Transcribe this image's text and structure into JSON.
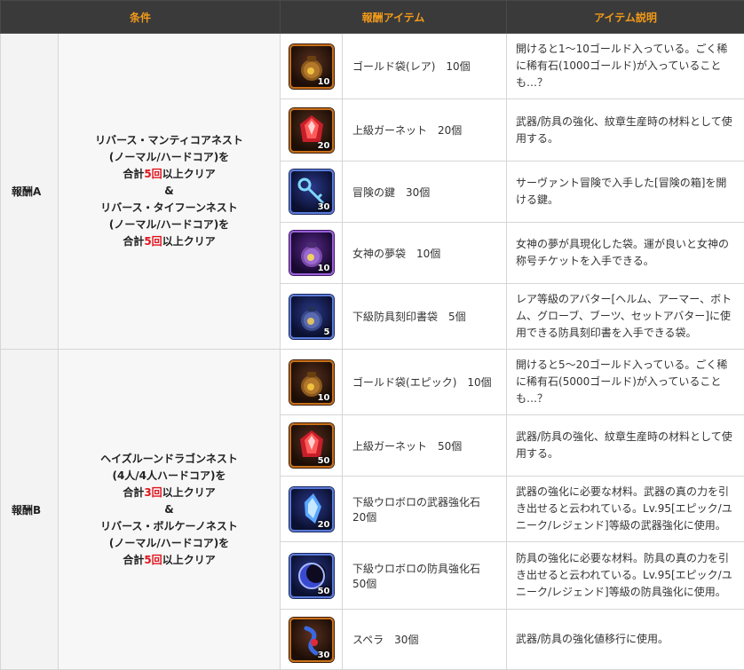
{
  "headers": {
    "condition": "条件",
    "reward_item": "報酬アイテム",
    "item_desc": "アイテム説明"
  },
  "rewards": [
    {
      "name": "報酬A",
      "condition": [
        {
          "text": "リバース・マンティコアネスト"
        },
        {
          "text": "(ノーマル/ハードコア)を"
        },
        {
          "pre": "合計",
          "num": "5回",
          "post": "以上クリア"
        },
        {
          "text": "&"
        },
        {
          "text": "リバース・タイフーンネスト"
        },
        {
          "text": "(ノーマル/ハードコア)を"
        },
        {
          "pre": "合計",
          "num": "5回",
          "post": "以上クリア"
        }
      ],
      "items": [
        {
          "icon": "gold-bag-icon",
          "qty": "10",
          "name": "ゴールド袋(レア)　10個",
          "desc": "開けると1～10ゴールド入っている。ごく稀に稀有石(1000ゴールド)が入っていることも…？"
        },
        {
          "icon": "garnet-icon",
          "qty": "20",
          "name": "上級ガーネット　20個",
          "desc": "武器/防具の強化、紋章生産時の材料として使用する。"
        },
        {
          "icon": "key-icon",
          "qty": "30",
          "name": "冒険の鍵　30個",
          "desc": "サーヴァント冒険で入手した[冒険の箱]を開ける鍵。"
        },
        {
          "icon": "goddess-bag-icon",
          "qty": "10",
          "name": "女神の夢袋　10個",
          "desc": "女神の夢が具現化した袋。運が良いと女神の称号チケットを入手できる。"
        },
        {
          "icon": "armor-seal-bag-icon",
          "qty": "5",
          "name": "下級防具刻印書袋　5個",
          "desc": "レア等級のアバター[ヘルム、アーマー、ボトム、グローブ、ブーツ、セットアバター]に使用できる防具刻印書を入手できる袋。"
        }
      ]
    },
    {
      "name": "報酬B",
      "condition": [
        {
          "text": "ヘイズルーンドラゴンネスト"
        },
        {
          "text": "(4人/4人ハードコア)を"
        },
        {
          "pre": "合計",
          "num": "3回",
          "post": "以上クリア"
        },
        {
          "text": "&"
        },
        {
          "text": "リバース・ボルケーノネスト"
        },
        {
          "text": "(ノーマル/ハードコア)を"
        },
        {
          "pre": "合計",
          "num": "5回",
          "post": "以上クリア"
        }
      ],
      "items": [
        {
          "icon": "gold-bag-icon",
          "qty": "10",
          "name": "ゴールド袋(エピック)　10個",
          "desc": "開けると5～20ゴールド入っている。ごく稀に稀有石(5000ゴールド)が入っていることも…？"
        },
        {
          "icon": "garnet-icon",
          "qty": "50",
          "name": "上級ガーネット　50個",
          "desc": "武器/防具の強化、紋章生産時の材料として使用する。"
        },
        {
          "icon": "weapon-stone-icon",
          "qty": "20",
          "name": "下級ウロボロの武器強化石",
          "name2": "20個",
          "desc": "武器の強化に必要な材料。武器の真の力を引き出せると云われている。Lv.95[エピック/ユニーク/レジェンド]等級の武器強化に使用。"
        },
        {
          "icon": "armor-stone-icon",
          "qty": "50",
          "name": "下級ウロボロの防具強化石",
          "name2": "50個",
          "desc": "防具の強化に必要な材料。防具の真の力を引き出せると云われている。Lv.95[エピック/ユニーク/レジェンド]等級の防具強化に使用。"
        },
        {
          "icon": "spera-icon",
          "qty": "30",
          "name": "スペラ　30個",
          "desc": "武器/防具の強化値移行に使用。"
        }
      ]
    }
  ]
}
